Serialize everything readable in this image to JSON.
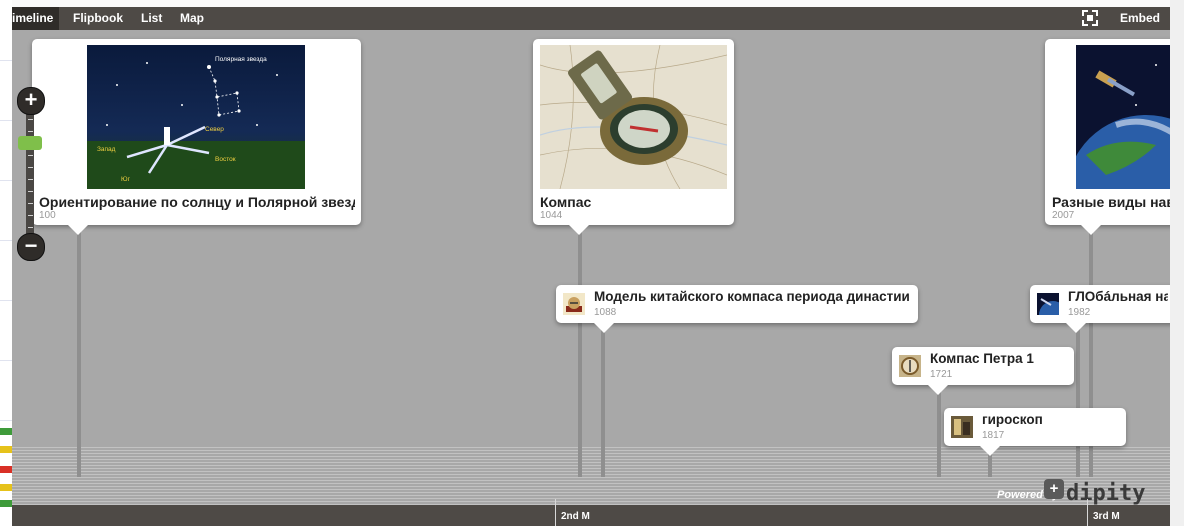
{
  "nav": {
    "tabs": [
      "imeline",
      "Flipbook",
      "List",
      "Map"
    ],
    "embed_label": "Embed"
  },
  "axis": {
    "labels": [
      "2nd M",
      "3rd M"
    ]
  },
  "events": [
    {
      "title": "Ориентирование по солнцу и Полярной звезде",
      "year": "100"
    },
    {
      "title": "Компас",
      "year": "1044"
    },
    {
      "title": "Разные виды навигации",
      "year": "2007"
    },
    {
      "title": "Модель китайского компаса периода династии",
      "year": "1088"
    },
    {
      "title": "ГЛОбáльная навигация",
      "year": "1982"
    },
    {
      "title": "Компас Петра 1",
      "year": "1721"
    },
    {
      "title": "гироскоп",
      "year": "1817"
    }
  ],
  "image_labels": {
    "polar_star": "Полярная звезда",
    "north": "Север",
    "west": "Запад",
    "east": "Восток",
    "south": "Юг"
  },
  "branding": {
    "powered": "Powered by",
    "logo": "dipity"
  },
  "icons": {
    "zoom_in": "plus-icon",
    "zoom_out": "minus-icon",
    "fullscreen": "fullscreen-icon",
    "add": "plus-icon"
  },
  "colors": {
    "timeline_bg": "#a8a8a8",
    "nav_bg": "#4e4a46",
    "card_bg": "#ffffff",
    "zoom_handle": "#7fbf4a"
  }
}
